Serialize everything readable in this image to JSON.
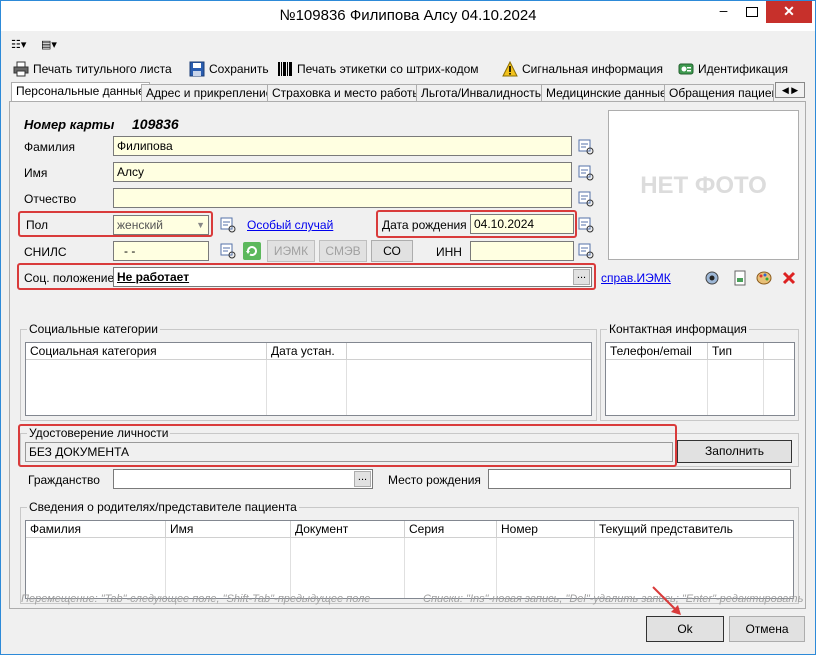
{
  "window": {
    "title": "№109836 Филипова Алсу  04.10.2024",
    "minimize_glyph": "–",
    "close_glyph": "✕"
  },
  "mini_toolbar": {
    "item1_glyph": "☷▾",
    "item2_glyph": "▤▾"
  },
  "toolbar": [
    {
      "label": "Печать титульного листа",
      "icon": "printer-icon"
    },
    {
      "label": "Сохранить",
      "icon": "save-icon"
    },
    {
      "label": "Печать этикетки со штрих-кодом",
      "icon": "barcode-icon"
    },
    {
      "label": "Сигнальная информация",
      "icon": "warning-icon"
    },
    {
      "label": "Идентификация",
      "icon": "identification-icon"
    }
  ],
  "tabs": [
    {
      "label": "Персональные данные",
      "active": true
    },
    {
      "label": "Адрес и прикрепление",
      "active": false
    },
    {
      "label": "Страховка и место работы",
      "active": false
    },
    {
      "label": "Льгота/Инвалидность",
      "active": false
    },
    {
      "label": "Медицинские данные",
      "active": false
    },
    {
      "label": "Обращения пациента",
      "active": false
    }
  ],
  "tab_scroll": {
    "left": "◀",
    "right": "▶"
  },
  "card": {
    "label": "Номер карты",
    "number": "109836"
  },
  "fields": {
    "last_name": {
      "label": "Фамилия",
      "value": "Филипова"
    },
    "first_name": {
      "label": "Имя",
      "value": "Алсу"
    },
    "patronymic": {
      "label": "Отчество",
      "value": ""
    },
    "gender": {
      "label": "Пол",
      "value": "женский"
    },
    "special_case": "Особый случай",
    "birth_date": {
      "label": "Дата рождения",
      "value": "04.10.2024"
    },
    "snils": {
      "label": "СНИЛС",
      "value": "-  -"
    },
    "inn": {
      "label": "ИНН",
      "value": ""
    },
    "social_status": {
      "label": "Соц. положение",
      "value": "Не работает"
    },
    "citizenship": {
      "label": "Гражданство",
      "value": ""
    },
    "birth_place": {
      "label": "Место рождения",
      "value": ""
    }
  },
  "buttons": {
    "iemk": "ИЭМК",
    "smev": "СМЭВ",
    "co": "СО",
    "fill": "Заполнить",
    "ok": "Ok",
    "cancel": "Отмена",
    "ellipsis": "..."
  },
  "links": {
    "iemk_ref": "справ.ИЭМК"
  },
  "photo_placeholder": "НЕТ ФОТО",
  "social_categories": {
    "title": "Социальные категории",
    "columns": [
      "Социальная категория",
      "Дата устан."
    ]
  },
  "contact_info": {
    "title": "Контактная информация",
    "columns": [
      "Телефон/email",
      "Тип"
    ]
  },
  "identity_document": {
    "title": "Удостоверение личности",
    "value": "БЕЗ ДОКУМЕНТА"
  },
  "parents": {
    "title": "Сведения о родителях/представителе пациента",
    "columns": [
      "Фамилия",
      "Имя",
      "Документ",
      "Серия",
      "Номер",
      "Текущий представитель"
    ]
  },
  "hints": {
    "left": "Перемещение: \"Tab\"-следующее поле, \"Shift-Tab\"-предыдущее поле",
    "right": "Списки: \"Ins\"-новая запись, \"Del\"-удалить запись; \"Enter\"-редактировать"
  },
  "colors": {
    "annotation": "#d93b3b",
    "close_button": "#c7302b",
    "required_field": "#ffffe1",
    "window_border": "#2d8ad8"
  }
}
